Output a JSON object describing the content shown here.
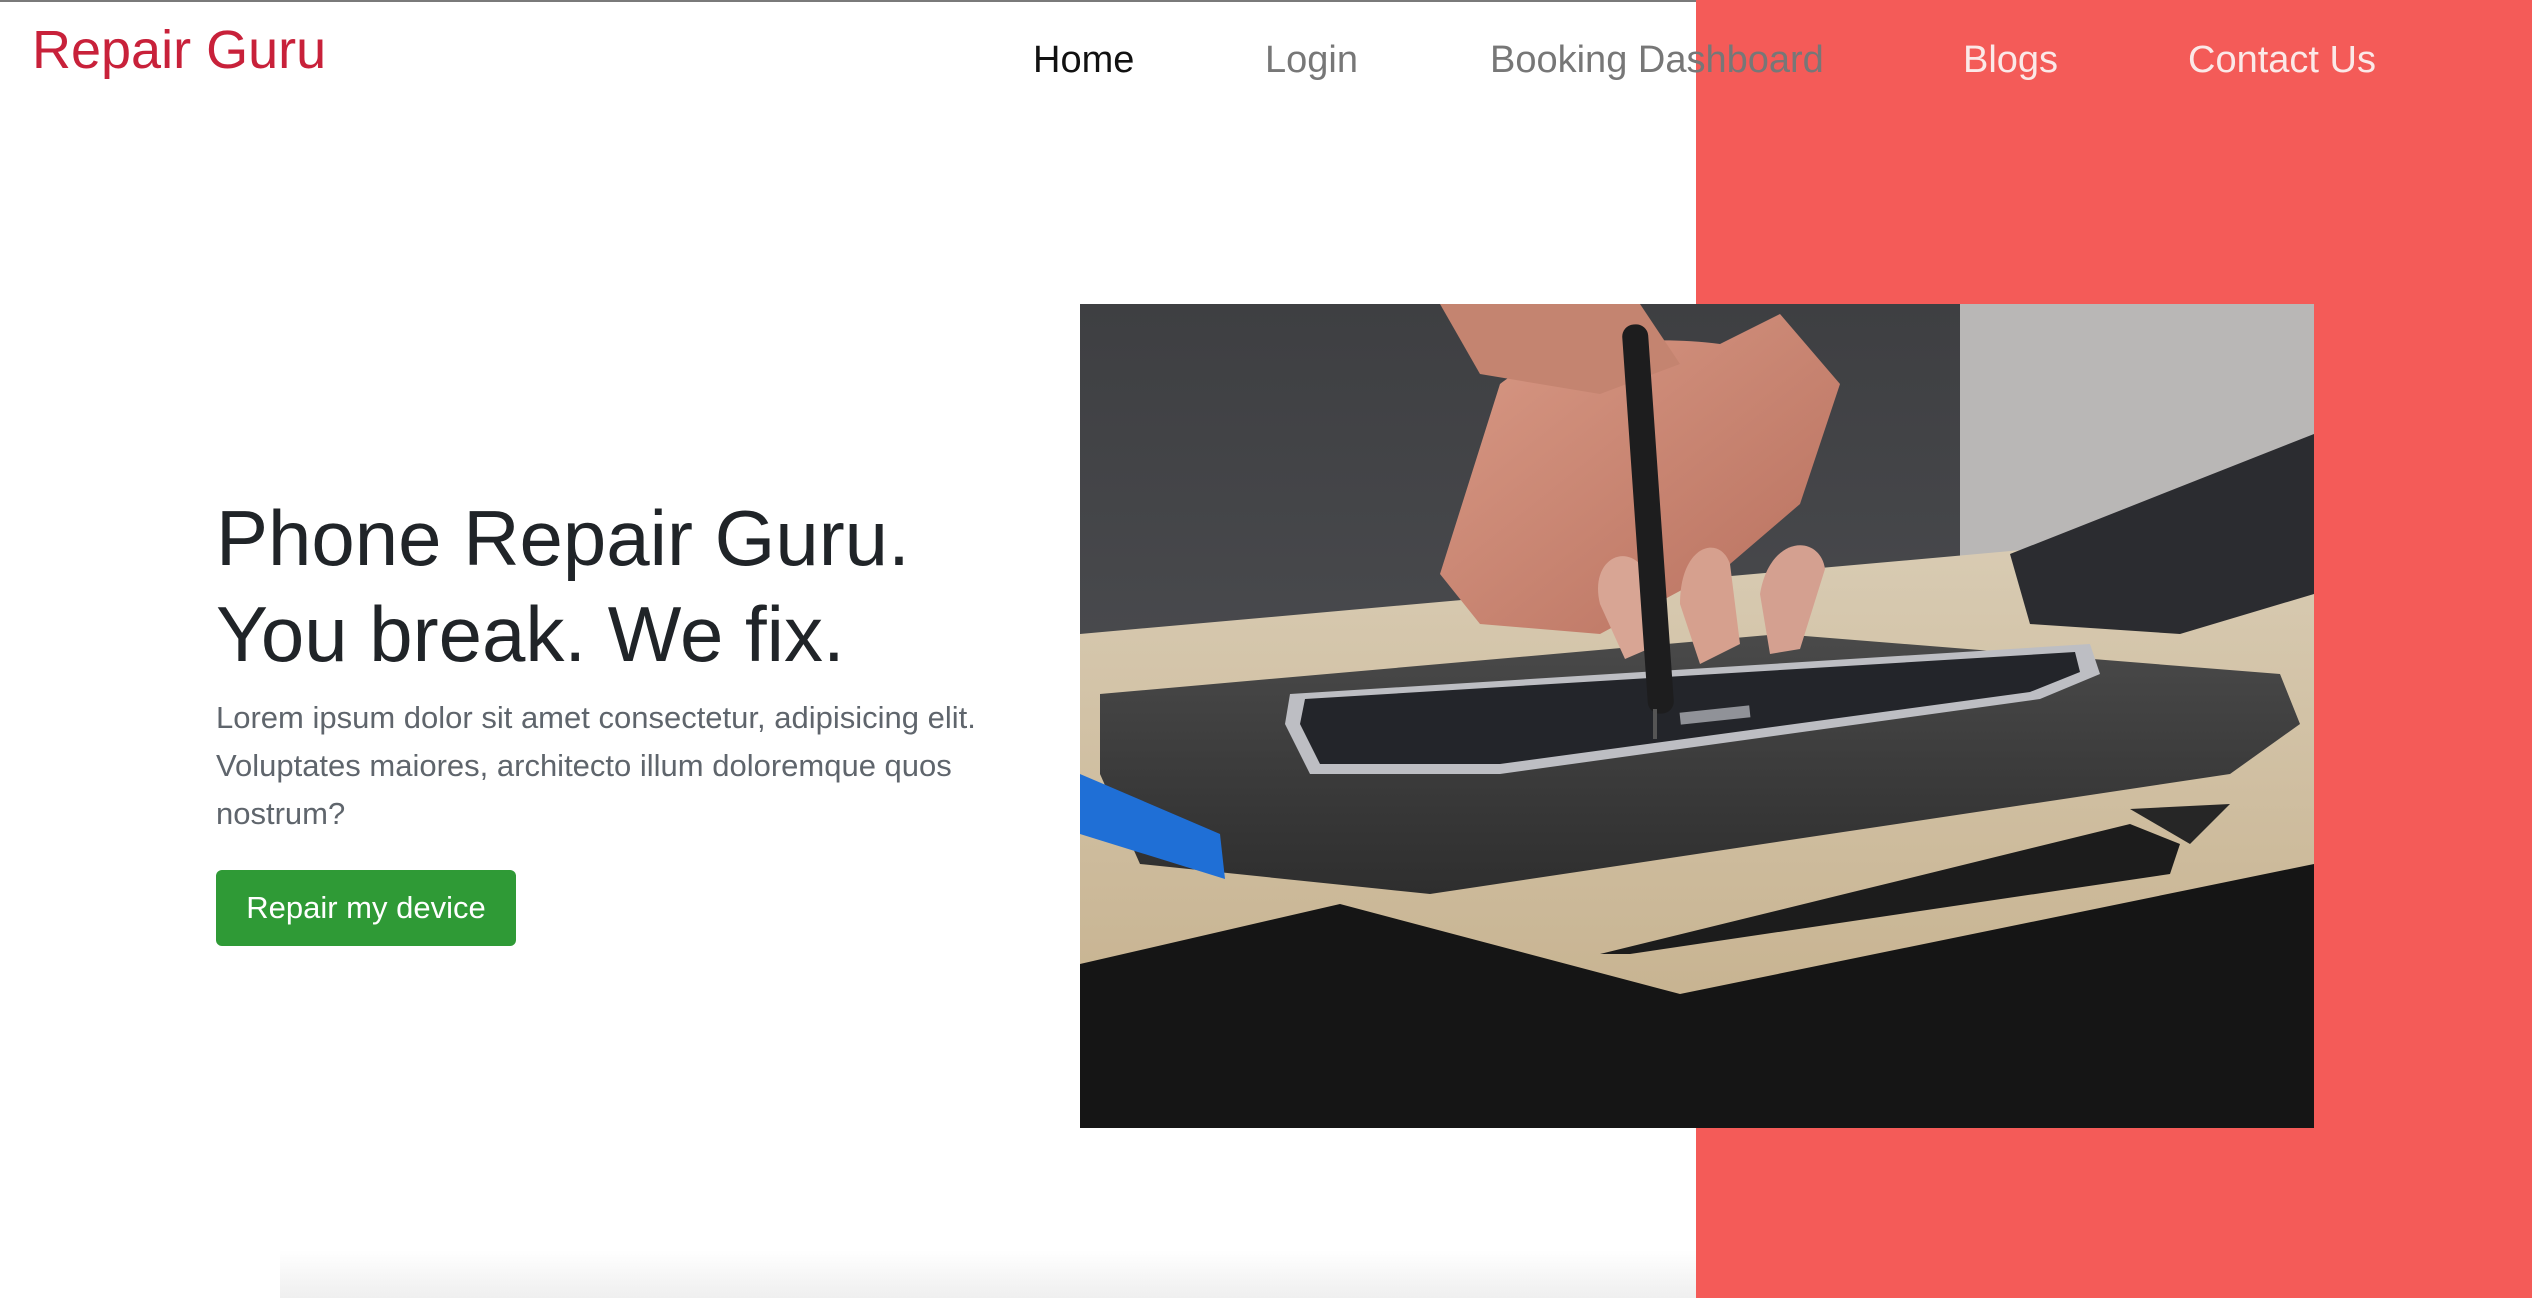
{
  "brand": {
    "name": "Repair Guru"
  },
  "nav": {
    "home": "Home",
    "login": "Login",
    "booking": "Booking Dashboard",
    "blogs": "Blogs",
    "contact": "Contact Us"
  },
  "hero": {
    "title_line1": "Phone Repair Guru.",
    "title_line2": "You break. We fix.",
    "description": "Lorem ipsum dolor sit amet consectetur, adipisicing elit. Voluptates maiores, architecto illum doloremque quos nostrum?",
    "button_label": "Repair my device"
  },
  "colors": {
    "brand": "#c8213a",
    "accent_panel": "#f45b58",
    "button": "#2f9a36"
  }
}
